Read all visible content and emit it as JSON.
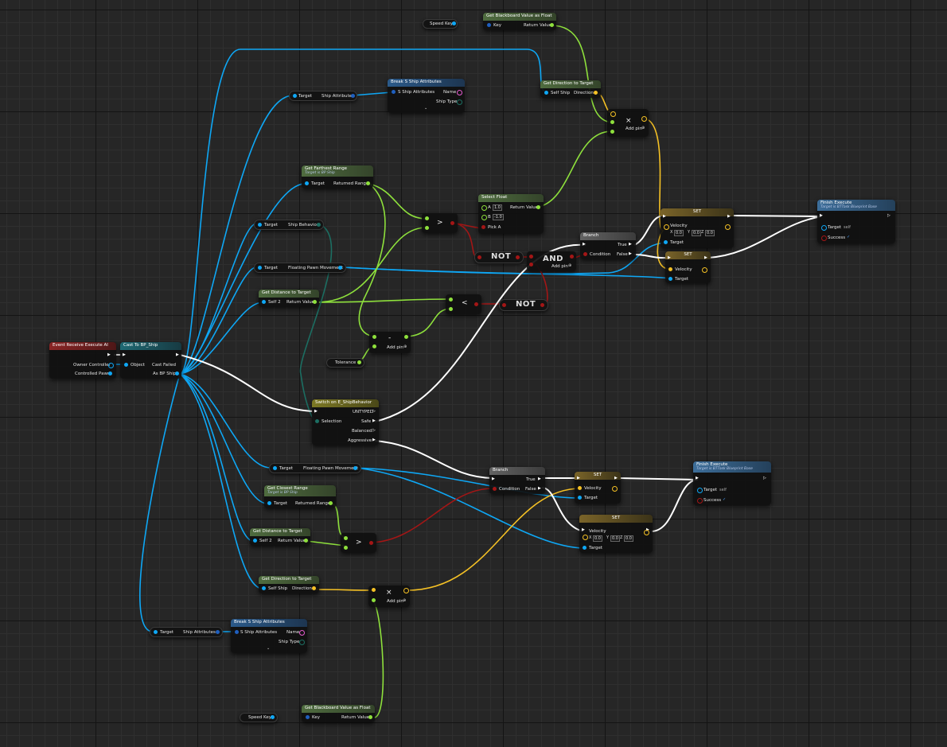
{
  "colors": {
    "exec": "#ffffff",
    "object": "#0ea7f5",
    "float": "#8ee03c",
    "bool": "#a31616",
    "vector": "#f5c125",
    "struct": "#1f5fbf",
    "name": "#e65cd0",
    "enum": "#1c6e62"
  },
  "nodes": {
    "event_execute": {
      "title": "Event Receive Execute AI",
      "owner_controller": "Owner Controller",
      "controlled_pawn": "Controlled Pawn"
    },
    "cast_ship": {
      "title": "Cast To BP_Ship",
      "object": "Object",
      "cast_failed": "Cast Failed",
      "as_bp_ship": "As BP Ship"
    },
    "get_bb_top": {
      "title": "Get Blackboard Value as Float",
      "key": "Key",
      "return_value": "Return Value"
    },
    "speed_key_top": {
      "label": "Speed Key"
    },
    "get_dir_top": {
      "title": "Get Direction to Target",
      "self_ship": "Self Ship",
      "direction": "Direction"
    },
    "break_attr_top": {
      "title": "Break S Ship Attributes",
      "s_ship_attributes": "S Ship Attributes",
      "name": "Name",
      "ship_type": "Ship Type"
    },
    "target_ship_attr_top": {
      "target": "Target",
      "ship_attributes": "Ship Attributes"
    },
    "mult_top": {
      "op": "×",
      "add_pin": "Add pin"
    },
    "farthest_range": {
      "title": "Get Farthest Range",
      "subtitle": "Target is BP Ship",
      "target": "Target",
      "returned_range": "Returned Range"
    },
    "select_float": {
      "title": "Select Float",
      "a": "A",
      "a_val": "1.0",
      "b": "B",
      "b_val": "-1.0",
      "pick_a": "Pick A",
      "return_value": "Return Value"
    },
    "greater_top": {
      "op": ">"
    },
    "ship_behavior_get": {
      "target": "Target",
      "ship_behavior": "Ship Behavior"
    },
    "floating_move_top": {
      "target": "Target",
      "floating_pawn_movement": "Floating Pawn Movement"
    },
    "not_1": {
      "label": "NOT"
    },
    "and_1": {
      "label": "AND",
      "add_pin": "Add pin"
    },
    "not_2": {
      "label": "NOT"
    },
    "dist_top": {
      "title": "Get Distance to Target",
      "self2": "Self 2",
      "return_value": "Return Value"
    },
    "less_top": {
      "op": "<"
    },
    "subtract": {
      "op": "-",
      "add_pin": "Add pin"
    },
    "tolerance": {
      "label": "Tolerance"
    },
    "branch_top": {
      "title": "Branch",
      "condition": "Condition",
      "true": "True",
      "false": "False"
    },
    "set_top_1": {
      "title": "SET",
      "velocity": "Velocity",
      "x": "X",
      "x_val": "0.0",
      "y": "Y",
      "y_val": "0.0",
      "z": "Z",
      "z_val": "0.0",
      "target": "Target"
    },
    "set_top_2": {
      "title": "SET",
      "velocity": "Velocity",
      "target": "Target"
    },
    "finish_top": {
      "title": "Finish Execute",
      "subtitle": "Target is BTTask Blueprint Base",
      "target": "Target",
      "target_val": "self",
      "success": "Success"
    },
    "switch": {
      "title": "Switch on E_ShipBehavior",
      "selection": "Selection",
      "untyped": "UNTYPED",
      "safe": "Safe",
      "balanced": "Balanced",
      "aggressive": "Aggressive"
    },
    "floating_move_bot": {
      "target": "Target",
      "floating_pawn_movement": "Floating Pawn Movement"
    },
    "closest_range": {
      "title": "Get Closest Range",
      "subtitle": "Target is BP Ship",
      "target": "Target",
      "returned_range": "Returned Range"
    },
    "dist_bot": {
      "title": "Get Distance to Target",
      "self2": "Self 2",
      "return_value": "Return Value"
    },
    "greater_bot": {
      "op": ">"
    },
    "branch_bot": {
      "title": "Branch",
      "condition": "Condition",
      "true": "True",
      "false": "False"
    },
    "set_bot_1": {
      "title": "SET",
      "velocity": "Velocity",
      "target": "Target"
    },
    "set_bot_2": {
      "title": "SET",
      "velocity": "Velocity",
      "x": "X",
      "x_val": "0.0",
      "y": "Y",
      "y_val": "0.0",
      "z": "Z",
      "z_val": "0.0",
      "target": "Target"
    },
    "finish_bot": {
      "title": "Finish Execute",
      "subtitle": "Target is BTTask Blueprint Base",
      "target": "Target",
      "target_val": "self",
      "success": "Success"
    },
    "get_dir_bot": {
      "title": "Get Direction to Target",
      "self_ship": "Self Ship",
      "direction": "Direction"
    },
    "mult_bot": {
      "op": "×",
      "add_pin": "Add pin"
    },
    "target_ship_attr_bot": {
      "target": "Target",
      "ship_attributes": "Ship Attributes"
    },
    "break_attr_bot": {
      "title": "Break S Ship Attributes",
      "s_ship_attributes": "S Ship Attributes",
      "name": "Name",
      "ship_type": "Ship Type"
    },
    "speed_key_bot": {
      "label": "Speed Key"
    },
    "get_bb_bot": {
      "title": "Get Blackboard Value as Float",
      "key": "Key",
      "return_value": "Return Value"
    }
  }
}
